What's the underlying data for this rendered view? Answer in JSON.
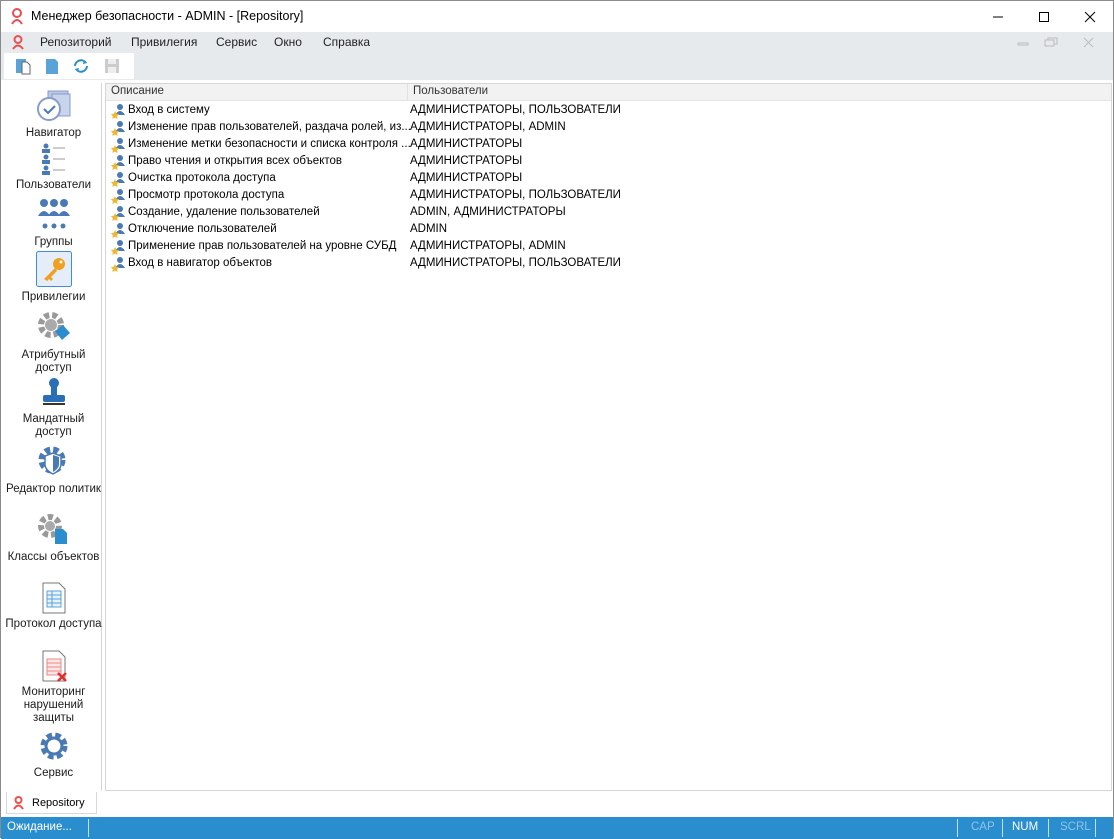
{
  "window": {
    "title": "Менеджер безопасности - ADMIN - [Repository]",
    "controls": [
      "minimize",
      "maximize",
      "close"
    ]
  },
  "menu": {
    "items": [
      "Репозиторий",
      "Привилегия",
      "Сервис",
      "Окно",
      "Справка"
    ]
  },
  "toolbar": {
    "icons": [
      "new-document-icon",
      "document-icon",
      "refresh-icon",
      "save-icon"
    ]
  },
  "sidebar": {
    "items": [
      {
        "label": "Навигатор",
        "icon": "navigator-icon"
      },
      {
        "label": "Пользователи",
        "icon": "users-icon"
      },
      {
        "label": "Группы",
        "icon": "groups-icon"
      },
      {
        "label": "Привилегии",
        "icon": "key-icon",
        "selected": true
      },
      {
        "label": "Атрибутный доступ",
        "icon": "gear-tag-icon"
      },
      {
        "label": "Мандатный доступ",
        "icon": "stamp-icon"
      },
      {
        "label": "Редактор политик",
        "icon": "gear-shield-icon"
      },
      {
        "label": "Классы объектов",
        "icon": "gear-document-icon"
      },
      {
        "label": "Протокол доступа",
        "icon": "log-icon"
      },
      {
        "label": "Мониторинг нарушений защиты",
        "icon": "log-error-icon"
      },
      {
        "label": "Сервис",
        "icon": "gear-icon"
      }
    ]
  },
  "table": {
    "columns": [
      "Описание",
      "Пользователи"
    ],
    "rows": [
      {
        "description": "Вход в систему",
        "users": "АДМИНИСТРАТОРЫ, ПОЛЬЗОВАТЕЛИ"
      },
      {
        "description": "Изменение прав пользователей, раздача ролей, из...",
        "users": "АДМИНИСТРАТОРЫ, ADMIN"
      },
      {
        "description": "Изменение метки безопасности и списка контроля ...",
        "users": "АДМИНИСТРАТОРЫ"
      },
      {
        "description": "Право чтения и открытия всех объектов",
        "users": "АДМИНИСТРАТОРЫ"
      },
      {
        "description": "Очистка протокола доступа",
        "users": "АДМИНИСТРАТОРЫ"
      },
      {
        "description": "Просмотр протокола доступа",
        "users": "АДМИНИСТРАТОРЫ, ПОЛЬЗОВАТЕЛИ"
      },
      {
        "description": "Создание, удаление пользователей",
        "users": "ADMIN, АДМИНИСТРАТОРЫ"
      },
      {
        "description": "Отключение пользователей",
        "users": "ADMIN"
      },
      {
        "description": "Применение прав пользователей на уровне СУБД",
        "users": "АДМИНИСТРАТОРЫ, ADMIN"
      },
      {
        "description": "Вход в навигатор объектов",
        "users": "АДМИНИСТРАТОРЫ, ПОЛЬЗОВАТЕЛИ"
      }
    ]
  },
  "tabs": [
    {
      "label": "Repository"
    }
  ],
  "status": {
    "text": "Ожидание...",
    "cap": "CAP",
    "num": "NUM",
    "scrl": "SCRL"
  },
  "colors": {
    "accent": "#2a8dcd",
    "icon_blue": "#4a7ab5",
    "key": "#f0a020"
  }
}
